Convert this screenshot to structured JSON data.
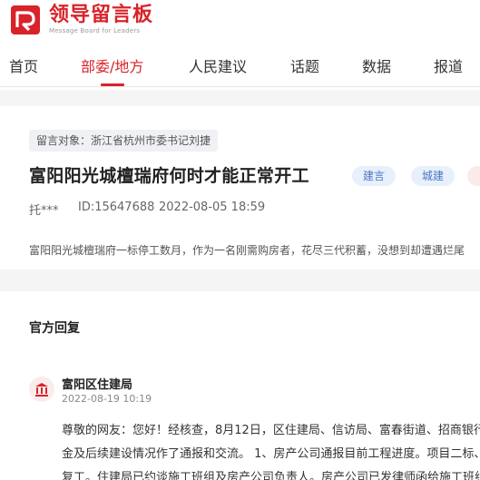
{
  "brand": {
    "title": "领导留言板",
    "subtitle": "Message Board for Leaders"
  },
  "nav": {
    "items": [
      {
        "label": "首页"
      },
      {
        "label": "部委/地方",
        "active": true
      },
      {
        "label": "人民建议"
      },
      {
        "label": "话题"
      },
      {
        "label": "数据"
      },
      {
        "label": "报道"
      }
    ]
  },
  "message": {
    "target_label": "留言对象：浙江省杭州市委书记刘捷",
    "title": "富阳阳光城檀瑞府何时才能正常开工",
    "tags": [
      "建言",
      "城建"
    ],
    "author": "托***",
    "id_text": "ID:15647688",
    "datetime": "2022-08-05 18:59",
    "excerpt": "富阳阳光城檀瑞府一标停工数月，作为一名刚需购房者，花尽三代积蓄，没想到却遭遇烂尾"
  },
  "reply": {
    "heading": "官方回复",
    "department": "富阳区住建局",
    "datetime": "2022-08-19 10:19",
    "lines": [
      "尊敬的网友：您好！经核查，8月12日，区住建局、信访局、富春街道、招商银行、",
      "金及后续建设情况作了通报和交流。 1、房产公司通报目前工程进度。项目二标、三",
      "复工。住建局已约谈施工班组及房产公司负责人。房产公司已发律师函给施工班组"
    ]
  },
  "colors": {
    "brand_red": "#d8232a",
    "tag_blue": "#4a78c4"
  }
}
